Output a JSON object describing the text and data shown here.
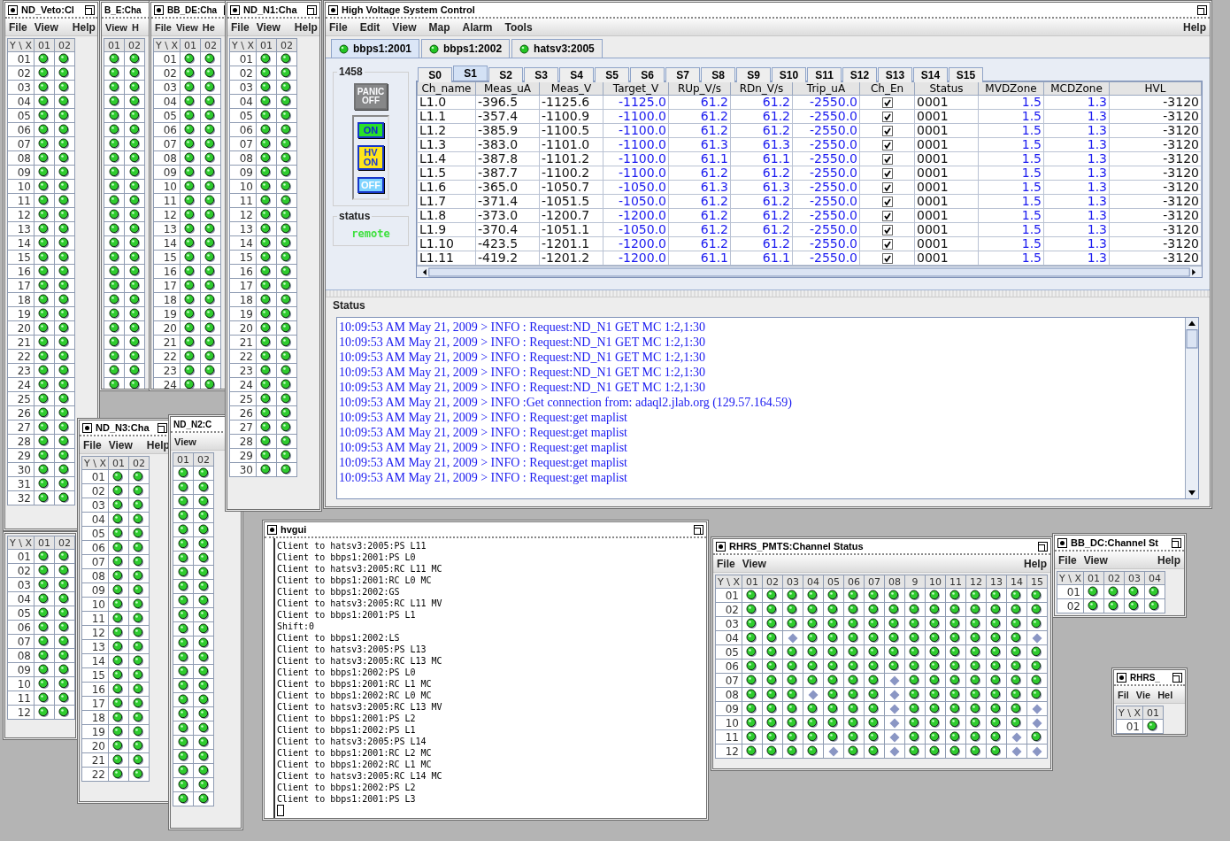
{
  "channel_windows": [
    {
      "title": "ND_Veto:Cl",
      "menu": {
        "left": [
          "File",
          "View"
        ],
        "right": [
          "Help"
        ]
      },
      "grid": {
        "corner": "Y \\ X",
        "columns": [
          "01",
          "02"
        ],
        "rows": [
          {
            "label": "01",
            "on": [
              true,
              true
            ]
          },
          {
            "label": "02",
            "on": [
              true,
              true
            ]
          },
          {
            "label": "03",
            "on": [
              true,
              true
            ]
          },
          {
            "label": "04",
            "on": [
              true,
              true
            ]
          },
          {
            "label": "05",
            "on": [
              true,
              true
            ]
          },
          {
            "label": "06",
            "on": [
              true,
              true
            ]
          },
          {
            "label": "07",
            "on": [
              true,
              true
            ]
          },
          {
            "label": "08",
            "on": [
              true,
              true
            ]
          },
          {
            "label": "09",
            "on": [
              true,
              true
            ]
          },
          {
            "label": "10",
            "on": [
              true,
              true
            ]
          },
          {
            "label": "11",
            "on": [
              true,
              true
            ]
          },
          {
            "label": "12",
            "on": [
              true,
              true
            ]
          },
          {
            "label": "13",
            "on": [
              true,
              true
            ]
          },
          {
            "label": "14",
            "on": [
              true,
              true
            ]
          },
          {
            "label": "15",
            "on": [
              true,
              true
            ]
          },
          {
            "label": "16",
            "on": [
              true,
              true
            ]
          },
          {
            "label": "17",
            "on": [
              true,
              true
            ]
          },
          {
            "label": "18",
            "on": [
              true,
              true
            ]
          },
          {
            "label": "19",
            "on": [
              true,
              true
            ]
          },
          {
            "label": "20",
            "on": [
              true,
              true
            ]
          },
          {
            "label": "21",
            "on": [
              true,
              true
            ]
          },
          {
            "label": "22",
            "on": [
              true,
              true
            ]
          },
          {
            "label": "23",
            "on": [
              true,
              true
            ]
          },
          {
            "label": "24",
            "on": [
              true,
              true
            ]
          },
          {
            "label": "25",
            "on": [
              true,
              true
            ]
          },
          {
            "label": "26",
            "on": [
              true,
              true
            ]
          },
          {
            "label": "27",
            "on": [
              true,
              true
            ]
          },
          {
            "label": "28",
            "on": [
              true,
              true
            ]
          },
          {
            "label": "29",
            "on": [
              true,
              true
            ]
          },
          {
            "label": "30",
            "on": [
              true,
              true
            ]
          },
          {
            "label": "31",
            "on": [
              true,
              true
            ]
          },
          {
            "label": "32",
            "on": [
              true,
              true
            ]
          }
        ]
      }
    },
    {
      "title": "B_E:Cha",
      "menu": {
        "left": [
          "View",
          "H"
        ]
      },
      "grid": {
        "columns": [
          "01",
          "02"
        ],
        "rows": [
          {
            "on": [
              true,
              true
            ]
          },
          {
            "on": [
              true,
              true
            ]
          },
          {
            "on": [
              true,
              true
            ]
          },
          {
            "on": [
              true,
              true
            ]
          },
          {
            "on": [
              true,
              true
            ]
          },
          {
            "on": [
              true,
              true
            ]
          },
          {
            "on": [
              true,
              true
            ]
          },
          {
            "on": [
              true,
              true
            ]
          },
          {
            "on": [
              true,
              true
            ]
          },
          {
            "on": [
              true,
              true
            ]
          },
          {
            "on": [
              true,
              true
            ]
          },
          {
            "on": [
              true,
              true
            ]
          },
          {
            "on": [
              true,
              true
            ]
          },
          {
            "on": [
              true,
              true
            ]
          },
          {
            "on": [
              true,
              true
            ]
          },
          {
            "on": [
              true,
              true
            ]
          },
          {
            "on": [
              true,
              true
            ]
          },
          {
            "on": [
              true,
              true
            ]
          },
          {
            "on": [
              true,
              true
            ]
          },
          {
            "on": [
              true,
              true
            ]
          },
          {
            "on": [
              true,
              true
            ]
          },
          {
            "on": [
              true,
              true
            ]
          },
          {
            "on": [
              true,
              true
            ]
          },
          {
            "on": [
              true,
              true
            ]
          }
        ]
      }
    },
    {
      "title": "BB_DE:Cha",
      "menu": {
        "left": [
          "File",
          "View",
          "He"
        ]
      },
      "grid": {
        "corner": "Y \\ X",
        "columns": [
          "01",
          "02"
        ],
        "rows": [
          {
            "label": "01",
            "on": [
              true,
              true
            ]
          },
          {
            "label": "02",
            "on": [
              true,
              true
            ]
          },
          {
            "label": "03",
            "on": [
              true,
              true
            ]
          },
          {
            "label": "04",
            "on": [
              true,
              true
            ]
          },
          {
            "label": "05",
            "on": [
              true,
              true
            ]
          },
          {
            "label": "06",
            "on": [
              true,
              true
            ]
          },
          {
            "label": "07",
            "on": [
              true,
              true
            ]
          },
          {
            "label": "08",
            "on": [
              true,
              true
            ]
          },
          {
            "label": "09",
            "on": [
              true,
              true
            ]
          },
          {
            "label": "10",
            "on": [
              true,
              true
            ]
          },
          {
            "label": "11",
            "on": [
              true,
              true
            ]
          },
          {
            "label": "12",
            "on": [
              true,
              true
            ]
          },
          {
            "label": "13",
            "on": [
              true,
              true
            ]
          },
          {
            "label": "14",
            "on": [
              true,
              true
            ]
          },
          {
            "label": "15",
            "on": [
              true,
              true
            ]
          },
          {
            "label": "16",
            "on": [
              true,
              true
            ]
          },
          {
            "label": "17",
            "on": [
              true,
              true
            ]
          },
          {
            "label": "18",
            "on": [
              true,
              true
            ]
          },
          {
            "label": "19",
            "on": [
              true,
              true
            ]
          },
          {
            "label": "20",
            "on": [
              true,
              true
            ]
          },
          {
            "label": "21",
            "on": [
              true,
              true
            ]
          },
          {
            "label": "22",
            "on": [
              true,
              true
            ]
          },
          {
            "label": "23",
            "on": [
              true,
              true
            ]
          },
          {
            "label": "24",
            "on": [
              true,
              true
            ]
          }
        ]
      }
    },
    {
      "grid": {
        "corner": "Y \\ X",
        "columns": [
          "01",
          "02"
        ],
        "rows": [
          {
            "label": "01",
            "on": [
              true,
              true
            ]
          },
          {
            "label": "02",
            "on": [
              true,
              true
            ]
          },
          {
            "label": "03",
            "on": [
              true,
              true
            ]
          },
          {
            "label": "04",
            "on": [
              true,
              true
            ]
          },
          {
            "label": "05",
            "on": [
              true,
              true
            ]
          },
          {
            "label": "06",
            "on": [
              true,
              true
            ]
          },
          {
            "label": "07",
            "on": [
              true,
              true
            ]
          },
          {
            "label": "08",
            "on": [
              true,
              true
            ]
          },
          {
            "label": "09",
            "on": [
              true,
              true
            ]
          },
          {
            "label": "10",
            "on": [
              true,
              true
            ]
          },
          {
            "label": "11",
            "on": [
              true,
              true
            ]
          },
          {
            "label": "12",
            "on": [
              true,
              true
            ]
          }
        ]
      }
    },
    {
      "title": "ND_N2:C",
      "menu": {
        "left": [
          "View"
        ]
      },
      "grid": {
        "columns": [
          "01",
          "02"
        ],
        "rows": [
          {
            "on": [
              true,
              true
            ]
          },
          {
            "on": [
              true,
              true
            ]
          },
          {
            "on": [
              true,
              true
            ]
          },
          {
            "on": [
              true,
              true
            ]
          },
          {
            "on": [
              true,
              true
            ]
          },
          {
            "on": [
              true,
              true
            ]
          },
          {
            "on": [
              true,
              true
            ]
          },
          {
            "on": [
              true,
              true
            ]
          },
          {
            "on": [
              true,
              true
            ]
          },
          {
            "on": [
              true,
              true
            ]
          },
          {
            "on": [
              true,
              true
            ]
          },
          {
            "on": [
              true,
              true
            ]
          },
          {
            "on": [
              true,
              true
            ]
          },
          {
            "on": [
              true,
              true
            ]
          },
          {
            "on": [
              true,
              true
            ]
          },
          {
            "on": [
              true,
              true
            ]
          },
          {
            "on": [
              true,
              true
            ]
          },
          {
            "on": [
              true,
              true
            ]
          },
          {
            "on": [
              true,
              true
            ]
          },
          {
            "on": [
              true,
              true
            ]
          },
          {
            "on": [
              true,
              true
            ]
          },
          {
            "on": [
              true,
              true
            ]
          },
          {
            "on": [
              true,
              true
            ]
          },
          {
            "on": [
              true,
              true
            ]
          }
        ]
      }
    },
    {
      "title": "ND_N1:Cha",
      "menu": {
        "left": [
          "File",
          "View"
        ],
        "right": [
          "Help"
        ]
      },
      "grid": {
        "corner": "Y \\ X",
        "columns": [
          "01",
          "02"
        ],
        "rows": [
          {
            "label": "01",
            "on": [
              true,
              true
            ]
          },
          {
            "label": "02",
            "on": [
              true,
              true
            ]
          },
          {
            "label": "03",
            "on": [
              true,
              true
            ]
          },
          {
            "label": "04",
            "on": [
              true,
              true
            ]
          },
          {
            "label": "05",
            "on": [
              true,
              true
            ]
          },
          {
            "label": "06",
            "on": [
              true,
              true
            ]
          },
          {
            "label": "07",
            "on": [
              true,
              true
            ]
          },
          {
            "label": "08",
            "on": [
              true,
              true
            ]
          },
          {
            "label": "09",
            "on": [
              true,
              true
            ]
          },
          {
            "label": "10",
            "on": [
              true,
              true
            ]
          },
          {
            "label": "11",
            "on": [
              true,
              true
            ]
          },
          {
            "label": "12",
            "on": [
              true,
              true
            ]
          },
          {
            "label": "13",
            "on": [
              true,
              true
            ]
          },
          {
            "label": "14",
            "on": [
              true,
              true
            ]
          },
          {
            "label": "15",
            "on": [
              true,
              true
            ]
          },
          {
            "label": "16",
            "on": [
              true,
              true
            ]
          },
          {
            "label": "17",
            "on": [
              true,
              true
            ]
          },
          {
            "label": "18",
            "on": [
              true,
              true
            ]
          },
          {
            "label": "19",
            "on": [
              true,
              true
            ]
          },
          {
            "label": "20",
            "on": [
              true,
              true
            ]
          },
          {
            "label": "21",
            "on": [
              true,
              true
            ]
          },
          {
            "label": "22",
            "on": [
              true,
              true
            ]
          },
          {
            "label": "23",
            "on": [
              true,
              true
            ]
          },
          {
            "label": "24",
            "on": [
              true,
              true
            ]
          },
          {
            "label": "25",
            "on": [
              true,
              true
            ]
          },
          {
            "label": "26",
            "on": [
              true,
              true
            ]
          },
          {
            "label": "27",
            "on": [
              true,
              true
            ]
          },
          {
            "label": "28",
            "on": [
              true,
              true
            ]
          },
          {
            "label": "29",
            "on": [
              true,
              true
            ]
          },
          {
            "label": "30",
            "on": [
              true,
              true
            ]
          }
        ]
      }
    },
    {
      "title": "ND_N3:Cha",
      "menu": {
        "left": [
          "File",
          "View"
        ],
        "right": [
          "Help"
        ]
      },
      "grid": {
        "corner": "Y \\ X",
        "columns": [
          "01",
          "02"
        ],
        "rows": [
          {
            "label": "01",
            "on": [
              true,
              true
            ]
          },
          {
            "label": "02",
            "on": [
              true,
              true
            ]
          },
          {
            "label": "03",
            "on": [
              true,
              true
            ]
          },
          {
            "label": "04",
            "on": [
              true,
              true
            ]
          },
          {
            "label": "05",
            "on": [
              true,
              true
            ]
          },
          {
            "label": "06",
            "on": [
              true,
              true
            ]
          },
          {
            "label": "07",
            "on": [
              true,
              true
            ]
          },
          {
            "label": "08",
            "on": [
              true,
              true
            ]
          },
          {
            "label": "09",
            "on": [
              true,
              true
            ]
          },
          {
            "label": "10",
            "on": [
              true,
              true
            ]
          },
          {
            "label": "11",
            "on": [
              true,
              true
            ]
          },
          {
            "label": "12",
            "on": [
              true,
              true
            ]
          },
          {
            "label": "13",
            "on": [
              true,
              true
            ]
          },
          {
            "label": "14",
            "on": [
              true,
              true
            ]
          },
          {
            "label": "15",
            "on": [
              true,
              true
            ]
          },
          {
            "label": "16",
            "on": [
              true,
              true
            ]
          },
          {
            "label": "17",
            "on": [
              true,
              true
            ]
          },
          {
            "label": "18",
            "on": [
              true,
              true
            ]
          },
          {
            "label": "19",
            "on": [
              true,
              true
            ]
          },
          {
            "label": "20",
            "on": [
              true,
              true
            ]
          },
          {
            "label": "21",
            "on": [
              true,
              true
            ]
          },
          {
            "label": "22",
            "on": [
              true,
              true
            ]
          }
        ]
      }
    },
    {
      "title": "RHRS_PMTS:Channel Status",
      "menu": {
        "left": [
          "File",
          "View"
        ],
        "right": [
          "Help"
        ]
      },
      "grid": {
        "corner": "Y \\ X",
        "columns": [
          "01",
          "02",
          "03",
          "04",
          "05",
          "06",
          "07",
          "08",
          "9",
          "10",
          "11",
          "12",
          "13",
          "14",
          "15"
        ],
        "rows": [
          {
            "label": "01",
            "on": [
              true,
              true,
              true,
              true,
              true,
              true,
              true,
              true,
              true,
              true,
              true,
              true,
              true,
              true,
              true
            ]
          },
          {
            "label": "02",
            "on": [
              true,
              true,
              true,
              true,
              true,
              true,
              true,
              true,
              true,
              true,
              true,
              true,
              true,
              true,
              true
            ]
          },
          {
            "label": "03",
            "on": [
              true,
              true,
              true,
              true,
              true,
              true,
              true,
              true,
              true,
              true,
              true,
              true,
              true,
              true,
              true
            ]
          },
          {
            "label": "04",
            "on": [
              true,
              true,
              false,
              true,
              true,
              true,
              true,
              true,
              true,
              true,
              true,
              true,
              true,
              true,
              false
            ]
          },
          {
            "label": "05",
            "on": [
              true,
              true,
              true,
              true,
              true,
              true,
              true,
              true,
              true,
              true,
              true,
              true,
              true,
              true,
              true
            ]
          },
          {
            "label": "06",
            "on": [
              true,
              true,
              true,
              true,
              true,
              true,
              true,
              true,
              true,
              true,
              true,
              true,
              true,
              true,
              true
            ]
          },
          {
            "label": "07",
            "on": [
              true,
              true,
              true,
              true,
              true,
              true,
              true,
              false,
              true,
              true,
              true,
              true,
              true,
              true,
              true
            ]
          },
          {
            "label": "08",
            "on": [
              true,
              true,
              true,
              false,
              true,
              true,
              true,
              false,
              true,
              true,
              true,
              true,
              true,
              true,
              true
            ]
          },
          {
            "label": "09",
            "on": [
              true,
              true,
              true,
              true,
              true,
              true,
              true,
              false,
              true,
              true,
              true,
              true,
              true,
              true,
              false
            ]
          },
          {
            "label": "10",
            "on": [
              true,
              true,
              true,
              true,
              true,
              true,
              true,
              false,
              true,
              true,
              true,
              true,
              true,
              true,
              false
            ]
          },
          {
            "label": "11",
            "on": [
              true,
              true,
              true,
              true,
              true,
              true,
              true,
              false,
              true,
              true,
              true,
              true,
              true,
              false,
              true
            ]
          },
          {
            "label": "12",
            "on": [
              true,
              true,
              true,
              true,
              false,
              true,
              true,
              false,
              true,
              true,
              true,
              true,
              true,
              false,
              false
            ]
          }
        ]
      }
    },
    {
      "title": "BB_DC:Channel St",
      "menu": {
        "left": [
          "File",
          "View"
        ],
        "right": [
          "Help"
        ]
      },
      "grid": {
        "corner": "Y \\ X",
        "columns": [
          "01",
          "02",
          "03",
          "04"
        ],
        "rows": [
          {
            "label": "01",
            "on": [
              true,
              true,
              true,
              true
            ]
          },
          {
            "label": "02",
            "on": [
              true,
              true,
              true,
              true
            ]
          }
        ]
      }
    },
    {
      "title": "RHRS_",
      "menu": {
        "left": [
          "Fil",
          "Vie",
          "Hel"
        ]
      },
      "grid": {
        "corner": "Y \\ X",
        "columns": [
          "01"
        ],
        "rows": [
          {
            "label": "01",
            "on": [
              true
            ]
          }
        ]
      }
    }
  ],
  "main_window": {
    "title": "High Voltage System Control",
    "menu": {
      "left": [
        "File",
        "Edit",
        "View",
        "Map",
        "Alarm",
        "Tools"
      ],
      "right": [
        "Help"
      ]
    },
    "host_tabs": [
      {
        "label": "bbps1:2001",
        "selected": true
      },
      {
        "label": "bbps1:2002",
        "selected": false
      },
      {
        "label": "hatsv3:2005",
        "selected": false
      }
    ],
    "crate": {
      "label": "1458",
      "controls": [
        {
          "label": "PANIC OFF",
          "kind": "panic",
          "disabled": true
        },
        {
          "label": "ON",
          "kind": "on",
          "disabled": false
        },
        {
          "label": "HV ON",
          "kind": "hv",
          "disabled": false
        },
        {
          "label": "OFF",
          "kind": "off",
          "disabled": false
        }
      ],
      "status_label": "status",
      "status_value": "remote"
    },
    "slot_tabs": [
      {
        "label": "S0",
        "selected": false
      },
      {
        "label": "S1",
        "selected": true
      },
      {
        "label": "S2",
        "selected": false
      },
      {
        "label": "S3",
        "selected": false
      },
      {
        "label": "S4",
        "selected": false
      },
      {
        "label": "S5",
        "selected": false
      },
      {
        "label": "S6",
        "selected": false
      },
      {
        "label": "S7",
        "selected": false
      },
      {
        "label": "S8",
        "selected": false
      },
      {
        "label": "S9",
        "selected": false
      },
      {
        "label": "S10",
        "selected": false
      },
      {
        "label": "S11",
        "selected": false
      },
      {
        "label": "S12",
        "selected": false
      },
      {
        "label": "S13",
        "selected": false
      },
      {
        "label": "S14",
        "selected": false
      },
      {
        "label": "S15",
        "selected": false
      }
    ],
    "table": {
      "columns": [
        {
          "label": "Ch_name",
          "kind": "text"
        },
        {
          "label": "Meas_uA",
          "kind": "text"
        },
        {
          "label": "Meas_V",
          "kind": "text"
        },
        {
          "label": "Target_V",
          "kind": "setting"
        },
        {
          "label": "RUp_V/s",
          "kind": "setting"
        },
        {
          "label": "RDn_V/s",
          "kind": "setting"
        },
        {
          "label": "Trip_uA",
          "kind": "setting"
        },
        {
          "label": "Ch_En",
          "kind": "check"
        },
        {
          "label": "Status",
          "kind": "text"
        },
        {
          "label": "MVDZone",
          "kind": "setting"
        },
        {
          "label": "MCDZone",
          "kind": "setting"
        },
        {
          "label": "HVL",
          "kind": "limit"
        }
      ],
      "rows": [
        {
          "cells": [
            "L1.0",
            "-396.5",
            "-1125.6",
            "-1125.0",
            "61.2",
            "61.2",
            "-2550.0",
            true,
            "0001",
            "1.5",
            "1.3",
            "-3120"
          ]
        },
        {
          "cells": [
            "L1.1",
            "-357.4",
            "-1100.9",
            "-1100.0",
            "61.2",
            "61.2",
            "-2550.0",
            true,
            "0001",
            "1.5",
            "1.3",
            "-3120"
          ]
        },
        {
          "cells": [
            "L1.2",
            "-385.9",
            "-1100.5",
            "-1100.0",
            "61.2",
            "61.2",
            "-2550.0",
            true,
            "0001",
            "1.5",
            "1.3",
            "-3120"
          ]
        },
        {
          "cells": [
            "L1.3",
            "-383.0",
            "-1101.0",
            "-1100.0",
            "61.3",
            "61.3",
            "-2550.0",
            true,
            "0001",
            "1.5",
            "1.3",
            "-3120"
          ]
        },
        {
          "cells": [
            "L1.4",
            "-387.8",
            "-1101.2",
            "-1100.0",
            "61.1",
            "61.1",
            "-2550.0",
            true,
            "0001",
            "1.5",
            "1.3",
            "-3120"
          ]
        },
        {
          "cells": [
            "L1.5",
            "-387.7",
            "-1100.2",
            "-1100.0",
            "61.2",
            "61.2",
            "-2550.0",
            true,
            "0001",
            "1.5",
            "1.3",
            "-3120"
          ]
        },
        {
          "cells": [
            "L1.6",
            "-365.0",
            "-1050.7",
            "-1050.0",
            "61.3",
            "61.3",
            "-2550.0",
            true,
            "0001",
            "1.5",
            "1.3",
            "-3120"
          ]
        },
        {
          "cells": [
            "L1.7",
            "-371.4",
            "-1051.5",
            "-1050.0",
            "61.2",
            "61.2",
            "-2550.0",
            true,
            "0001",
            "1.5",
            "1.3",
            "-3120"
          ]
        },
        {
          "cells": [
            "L1.8",
            "-373.0",
            "-1200.7",
            "-1200.0",
            "61.2",
            "61.2",
            "-2550.0",
            true,
            "0001",
            "1.5",
            "1.3",
            "-3120"
          ]
        },
        {
          "cells": [
            "L1.9",
            "-370.4",
            "-1051.1",
            "-1050.0",
            "61.2",
            "61.2",
            "-2550.0",
            true,
            "0001",
            "1.5",
            "1.3",
            "-3120"
          ]
        },
        {
          "cells": [
            "L1.10",
            "-423.5",
            "-1201.1",
            "-1200.0",
            "61.2",
            "61.2",
            "-2550.0",
            true,
            "0001",
            "1.5",
            "1.3",
            "-3120"
          ]
        },
        {
          "cells": [
            "L1.11",
            "-419.2",
            "-1201.2",
            "-1200.0",
            "61.1",
            "61.1",
            "-2550.0",
            true,
            "0001",
            "1.5",
            "1.3",
            "-3120"
          ]
        }
      ]
    },
    "status": {
      "title": "Status",
      "lines": [
        "10:09:53 AM May 21, 2009 > INFO : Request:ND_N1 GET MC 1:2,1:30",
        "10:09:53 AM May 21, 2009 > INFO : Request:ND_N1 GET MC 1:2,1:30",
        "10:09:53 AM May 21, 2009 > INFO : Request:ND_N1 GET MC 1:2,1:30",
        "10:09:53 AM May 21, 2009 > INFO : Request:ND_N1 GET MC 1:2,1:30",
        "10:09:53 AM May 21, 2009 > INFO : Request:ND_N1 GET MC 1:2,1:30",
        "10:09:53 AM May 21, 2009 > INFO :Get connection from: adaql2.jlab.org (129.57.164.59)",
        "10:09:53 AM May 21, 2009 > INFO : Request:get maplist",
        "10:09:53 AM May 21, 2009 > INFO : Request:get maplist",
        "10:09:53 AM May 21, 2009 > INFO : Request:get maplist",
        "10:09:53 AM May 21, 2009 > INFO : Request:get maplist",
        "10:09:53 AM May 21, 2009 > INFO : Request:get maplist"
      ]
    }
  },
  "console_window": {
    "title": "hvgui",
    "lines": [
      "Client to hatsv3:2005:PS L11",
      "Client to bbps1:2001:PS L0",
      "Client to hatsv3:2005:RC L11 MC",
      "Client to bbps1:2001:RC L0 MC",
      "Client to bbps1:2002:GS",
      "Client to hatsv3:2005:RC L11 MV",
      "Client to bbps1:2001:PS L1",
      "Shift:0",
      "Client to bbps1:2002:LS",
      "Client to hatsv3:2005:PS L13",
      "Client to hatsv3:2005:RC L13 MC",
      "Client to bbps1:2002:PS L0",
      "Client to bbps1:2001:RC L1 MC",
      "Client to bbps1:2002:RC L0 MC",
      "Client to hatsv3:2005:RC L13 MV",
      "Client to bbps1:2001:PS L2",
      "Client to bbps1:2002:PS L1",
      "Client to hatsv3:2005:PS L14",
      "Client to bbps1:2001:RC L2 MC",
      "Client to bbps1:2002:RC L1 MC",
      "Client to hatsv3:2005:RC L14 MC",
      "Client to bbps1:2002:PS L2",
      "Client to bbps1:2001:PS L3"
    ]
  }
}
